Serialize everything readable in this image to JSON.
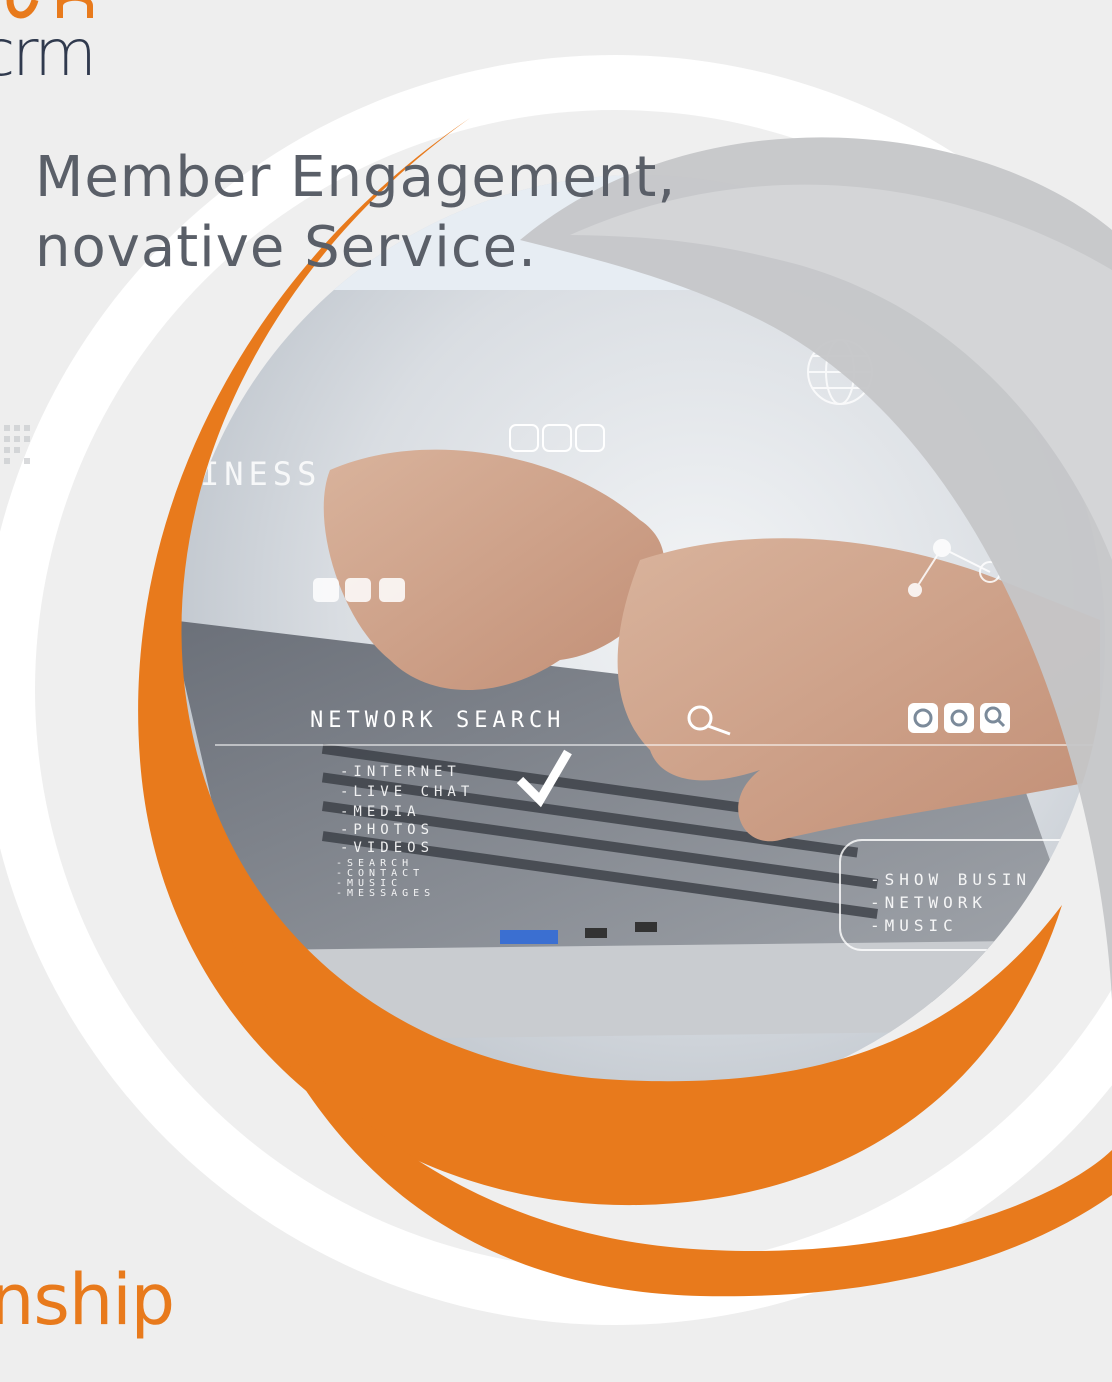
{
  "logo": {
    "wordmark": "crm"
  },
  "headline": {
    "line1": "Member Engagement,",
    "line2": "novative Service."
  },
  "tagline": {
    "line1": "nship",
    "line2": ""
  },
  "overlay": {
    "business": "INESS",
    "network_search": "NETWORK SEARCH",
    "menu_items": [
      "-INTERNET",
      "-LIVE CHAT",
      "-MEDIA",
      "-PHOTOS",
      "-VIDEOS",
      "-SEARCH",
      "-CONTACT",
      "-MUSIC",
      "-MESSAGES"
    ],
    "show_business": "-SHOW BUSIN",
    "network": "-NETWORK",
    "music": "-MUSIC"
  },
  "icons": [
    "chat-bubble-icon",
    "refresh-icon",
    "gear-icon",
    "search-icon",
    "globe-icon",
    "check-icon"
  ],
  "colors": {
    "accent": "#e87a1c",
    "navy": "#303a4e",
    "gray_text": "#5a5f68",
    "background": "#eeeeee"
  }
}
